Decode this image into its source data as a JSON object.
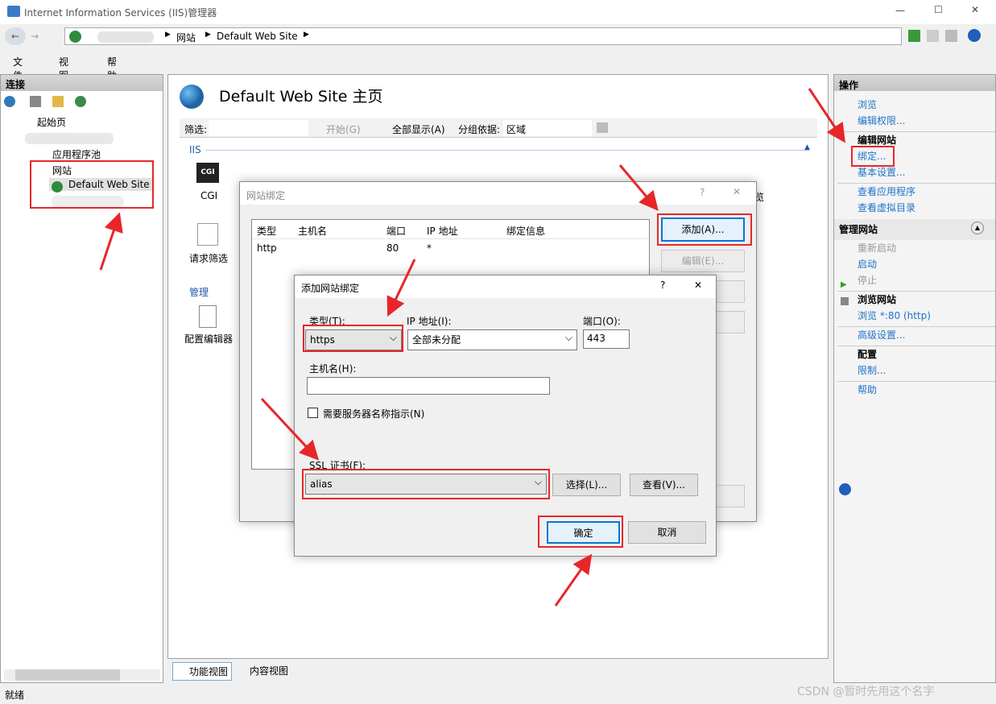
{
  "window": {
    "title": "Internet Information Services (IIS)管理器",
    "min": "—",
    "max": "☐",
    "close": "✕"
  },
  "address": {
    "crumbs": [
      "网站",
      "Default Web Site"
    ]
  },
  "menu": [
    "文件(F)",
    "视图(V)",
    "帮助(H)"
  ],
  "connections": {
    "title": "连接",
    "tree": [
      "起始页",
      "应用程序池",
      "网站",
      "Default Web Site"
    ]
  },
  "main": {
    "title": "Default Web Site 主页",
    "filter_label": "筛选:",
    "start": "开始(G)",
    "show_all": "全部显示(A)",
    "group_label": "分组依据:",
    "group_value": "区域",
    "section_iis": "IIS",
    "section_manage": "管理",
    "features": [
      "CGI",
      "浏览",
      "请求筛选",
      "配置编辑器"
    ],
    "tabs": [
      "功能视图",
      "内容视图"
    ]
  },
  "actions": {
    "title": "操作",
    "browse": "浏览",
    "edit_perms": "编辑权限...",
    "edit_site": "编辑网站",
    "bindings": "绑定...",
    "basic": "基本设置...",
    "view_apps": "查看应用程序",
    "view_vdirs": "查看虚拟目录",
    "manage_site": "管理网站",
    "restart": "重新启动",
    "start": "启动",
    "stop": "停止",
    "browse_site": "浏览网站",
    "browse_80": "浏览 *:80 (http)",
    "advanced": "高级设置...",
    "config": "配置",
    "limits": "限制...",
    "help": "帮助"
  },
  "bindings_dialog": {
    "title": "网站绑定",
    "help": "?",
    "close": "✕",
    "columns": [
      "类型",
      "主机名",
      "端口",
      "IP 地址",
      "绑定信息"
    ],
    "rows": [
      {
        "type": "http",
        "host": "",
        "port": "80",
        "ip": "*",
        "info": ""
      }
    ],
    "add": "添加(A)...",
    "edit": "编辑(E)..."
  },
  "add_dialog": {
    "title": "添加网站绑定",
    "help": "?",
    "close": "✕",
    "type_label": "类型(T):",
    "type_value": "https",
    "ip_label": "IP 地址(I):",
    "ip_value": "全部未分配",
    "port_label": "端口(O):",
    "port_value": "443",
    "host_label": "主机名(H):",
    "host_value": "",
    "sni_label": "需要服务器名称指示(N)",
    "sni_checked": false,
    "ssl_label": "SSL 证书(F):",
    "ssl_value": "alias",
    "select": "选择(L)...",
    "view": "查看(V)...",
    "ok": "确定",
    "cancel": "取消"
  },
  "status": {
    "text": "就绪",
    "watermark": "CSDN @暂时先用这个名字"
  },
  "colors": {
    "annotation": "#e8262a",
    "link": "#1e73c8"
  }
}
